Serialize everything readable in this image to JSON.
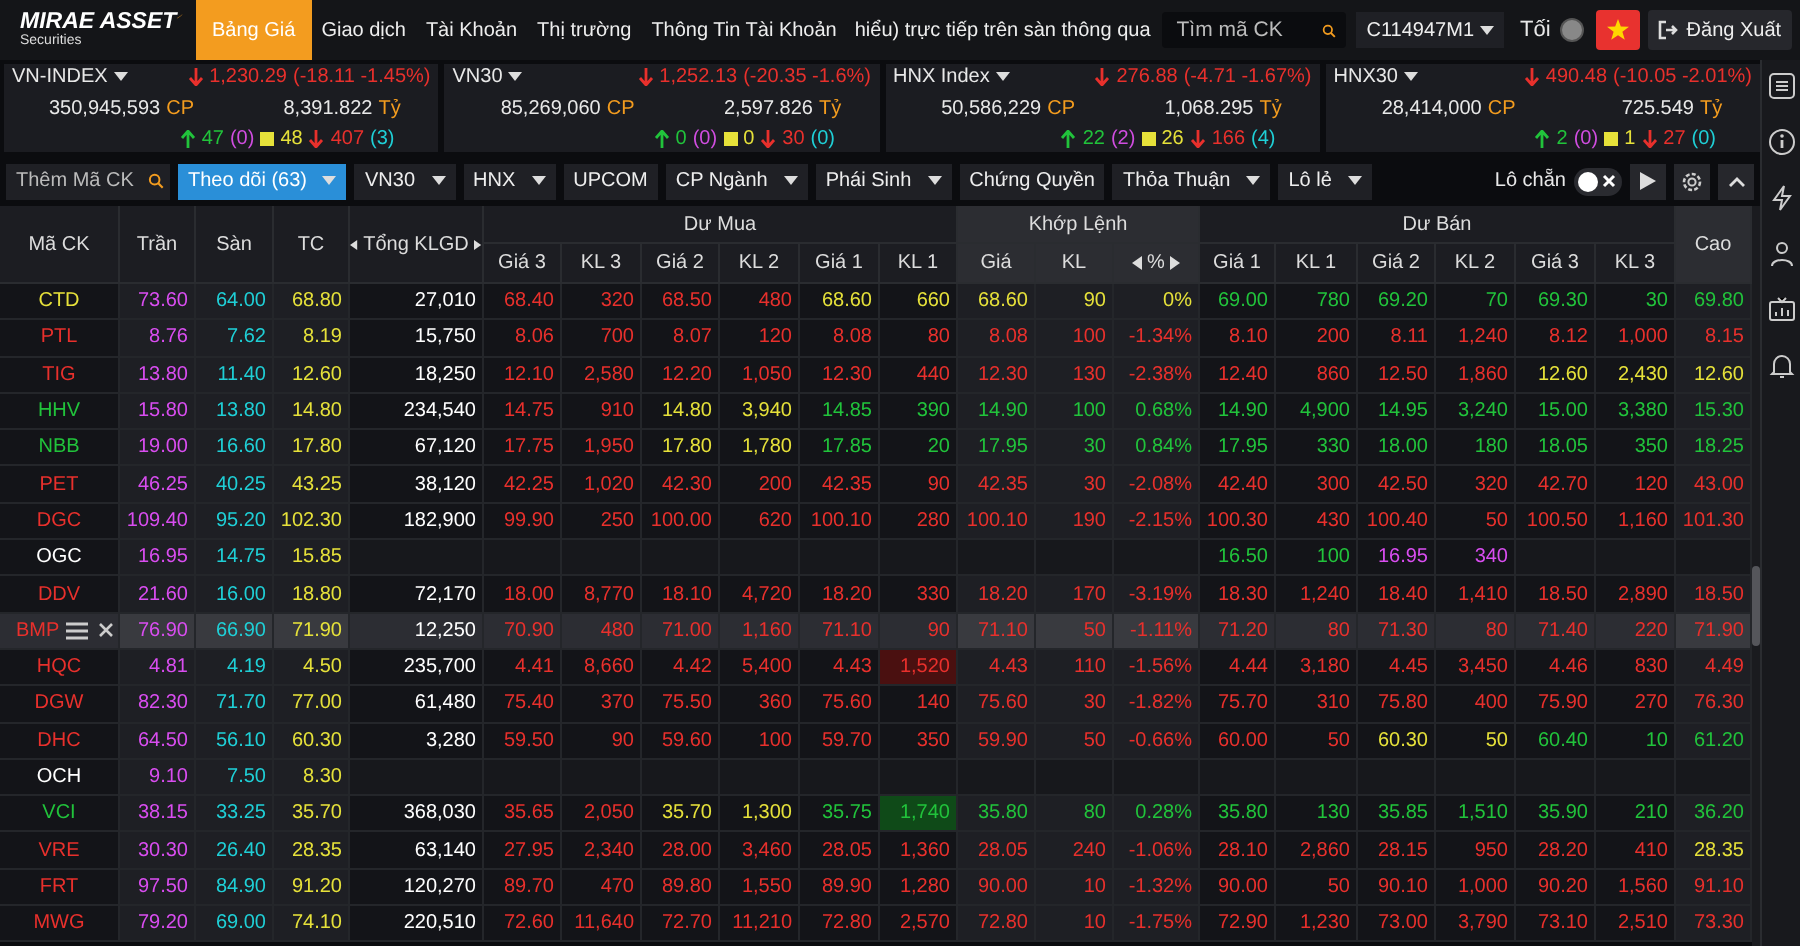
{
  "topnav": {
    "logo": {
      "name": "MIRAE ASSET",
      "tagline": "Securities"
    },
    "tabs": [
      {
        "label": "Bảng Giá",
        "selected": true
      },
      {
        "label": "Giao dịch",
        "selected": false
      },
      {
        "label": "Tài Khoản",
        "selected": false
      },
      {
        "label": "Thị trường",
        "selected": false
      },
      {
        "label": "Thông Tin Tài Khoản",
        "selected": false
      }
    ],
    "ticker": "hiểu) trực tiếp trên sàn thông qua",
    "search": {
      "placeholder": "Tìm mã CK"
    },
    "account": "C114947M1",
    "theme": {
      "label": "Tối",
      "on": false
    },
    "logout": "Đăng Xuất"
  },
  "indices": [
    {
      "name": "VN-INDEX",
      "value": "1,230.29",
      "change": "(-18.11 -1.45%)",
      "volume": "350,945,593",
      "volume_unit": "CP",
      "turnover": "8,391.822",
      "turnover_unit": "Tỷ",
      "up": "47",
      "ceil": "(0)",
      "ref": "48",
      "down": "407",
      "floor": "(3)"
    },
    {
      "name": "VN30",
      "value": "1,252.13",
      "change": "(-20.35 -1.6%)",
      "volume": "85,269,060",
      "volume_unit": "CP",
      "turnover": "2,597.826",
      "turnover_unit": "Tỷ",
      "up": "0",
      "ceil": "(0)",
      "ref": "0",
      "down": "30",
      "floor": "(0)"
    },
    {
      "name": "HNX Index",
      "value": "276.88",
      "change": "(-4.71 -1.67%)",
      "volume": "50,586,229",
      "volume_unit": "CP",
      "turnover": "1,068.295",
      "turnover_unit": "Tỷ",
      "up": "22",
      "ceil": "(2)",
      "ref": "26",
      "down": "166",
      "floor": "(4)"
    },
    {
      "name": "HNX30",
      "value": "490.48",
      "change": "(-10.05 -2.01%)",
      "volume": "28,414,000",
      "volume_unit": "CP",
      "turnover": "725.549",
      "turnover_unit": "Tỷ",
      "up": "2",
      "ceil": "(0)",
      "ref": "1",
      "down": "27",
      "floor": "(0)"
    }
  ],
  "toolbar": {
    "add_field": {
      "placeholder": "Thêm Mã CK"
    },
    "tabs": [
      {
        "label": "Theo dõi (63)",
        "selected": true,
        "dropdown": true
      },
      {
        "label": "VN30",
        "selected": false,
        "dropdown": true
      },
      {
        "label": "HNX",
        "selected": false,
        "dropdown": true
      },
      {
        "label": "UPCOM",
        "selected": false,
        "dropdown": false
      },
      {
        "label": "CP Ngành",
        "selected": false,
        "dropdown": true
      },
      {
        "label": "Phái Sinh",
        "selected": false,
        "dropdown": true
      },
      {
        "label": "Chứng Quyền",
        "selected": false,
        "dropdown": false
      },
      {
        "label": "Thỏa Thuận",
        "selected": false,
        "dropdown": true
      },
      {
        "label": "Lô lẻ",
        "selected": false,
        "dropdown": true
      }
    ],
    "odd_lot_toggle": {
      "label": "Lô chẵn",
      "on": false
    }
  },
  "board": {
    "columns": {
      "fixed": [
        {
          "label": "Mã CK",
          "arrows": false
        },
        {
          "label": "Trần",
          "arrows": false
        },
        {
          "label": "Sàn",
          "arrows": false
        },
        {
          "label": "TC",
          "arrows": false
        },
        {
          "label": "Tổng KLGD",
          "arrows": true
        }
      ],
      "groups": [
        {
          "label": "Dư Mua",
          "columns": [
            {
              "label": "Giá 3",
              "arrows": false
            },
            {
              "label": "KL 3",
              "arrows": false
            },
            {
              "label": "Giá 2",
              "arrows": false
            },
            {
              "label": "KL 2",
              "arrows": false
            },
            {
              "label": "Giá 1",
              "arrows": false
            },
            {
              "label": "KL 1",
              "arrows": false
            }
          ]
        },
        {
          "label": "Khớp Lệnh",
          "columns": [
            {
              "label": "Giá",
              "arrows": false
            },
            {
              "label": "KL",
              "arrows": false
            },
            {
              "label": "%",
              "arrows": true
            }
          ]
        },
        {
          "label": "Dư Bán",
          "columns": [
            {
              "label": "Giá 1",
              "arrows": false
            },
            {
              "label": "KL 1",
              "arrows": false
            },
            {
              "label": "Giá 2",
              "arrows": false
            },
            {
              "label": "KL 2",
              "arrows": false
            },
            {
              "label": "Giá 3",
              "arrows": false
            },
            {
              "label": "KL 3",
              "arrows": false
            }
          ]
        }
      ],
      "end": [
        {
          "label": "Cao",
          "arrows": false
        }
      ]
    },
    "rows": [
      {
        "code": "CTD",
        "color": "#e6e13a",
        "selected": false,
        "cells": [
          {
            "text": "73.60",
            "color": "#d94df0"
          },
          {
            "text": "64.00",
            "color": "#1fcfd6"
          },
          {
            "text": "68.80",
            "color": "#e6e13a"
          },
          {
            "text": "27,010",
            "color": "#ffffff"
          },
          {
            "text": "68.40",
            "color": "#e8302c"
          },
          {
            "text": "320",
            "color": "#e8302c"
          },
          {
            "text": "68.50",
            "color": "#e8302c"
          },
          {
            "text": "480",
            "color": "#e8302c"
          },
          {
            "text": "68.60",
            "color": "#e6e13a"
          },
          {
            "text": "660",
            "color": "#e6e13a"
          },
          {
            "text": "68.60",
            "color": "#e6e13a"
          },
          {
            "text": "90",
            "color": "#e6e13a"
          },
          {
            "text": "0%",
            "color": "#e6e13a"
          },
          {
            "text": "69.00",
            "color": "#21c33b"
          },
          {
            "text": "780",
            "color": "#21c33b"
          },
          {
            "text": "69.20",
            "color": "#21c33b"
          },
          {
            "text": "70",
            "color": "#21c33b"
          },
          {
            "text": "69.30",
            "color": "#21c33b"
          },
          {
            "text": "30",
            "color": "#21c33b"
          },
          {
            "text": "69.80",
            "color": "#21c33b"
          }
        ]
      },
      {
        "code": "PTL",
        "color": "#e8302c",
        "selected": false,
        "cells": [
          {
            "text": "8.76",
            "color": "#d94df0"
          },
          {
            "text": "7.62",
            "color": "#1fcfd6"
          },
          {
            "text": "8.19",
            "color": "#e6e13a"
          },
          {
            "text": "15,750",
            "color": "#ffffff"
          },
          {
            "text": "8.06",
            "color": "#e8302c"
          },
          {
            "text": "700",
            "color": "#e8302c"
          },
          {
            "text": "8.07",
            "color": "#e8302c"
          },
          {
            "text": "120",
            "color": "#e8302c"
          },
          {
            "text": "8.08",
            "color": "#e8302c"
          },
          {
            "text": "80",
            "color": "#e8302c"
          },
          {
            "text": "8.08",
            "color": "#e8302c"
          },
          {
            "text": "100",
            "color": "#e8302c"
          },
          {
            "text": "-1.34%",
            "color": "#e8302c"
          },
          {
            "text": "8.10",
            "color": "#e8302c"
          },
          {
            "text": "200",
            "color": "#e8302c"
          },
          {
            "text": "8.11",
            "color": "#e8302c"
          },
          {
            "text": "1,240",
            "color": "#e8302c"
          },
          {
            "text": "8.12",
            "color": "#e8302c"
          },
          {
            "text": "1,000",
            "color": "#e8302c"
          },
          {
            "text": "8.15",
            "color": "#e8302c"
          }
        ]
      },
      {
        "code": "TIG",
        "color": "#e8302c",
        "selected": false,
        "cells": [
          {
            "text": "13.80",
            "color": "#d94df0"
          },
          {
            "text": "11.40",
            "color": "#1fcfd6"
          },
          {
            "text": "12.60",
            "color": "#e6e13a"
          },
          {
            "text": "18,250",
            "color": "#ffffff"
          },
          {
            "text": "12.10",
            "color": "#e8302c"
          },
          {
            "text": "2,580",
            "color": "#e8302c"
          },
          {
            "text": "12.20",
            "color": "#e8302c"
          },
          {
            "text": "1,050",
            "color": "#e8302c"
          },
          {
            "text": "12.30",
            "color": "#e8302c"
          },
          {
            "text": "440",
            "color": "#e8302c"
          },
          {
            "text": "12.30",
            "color": "#e8302c"
          },
          {
            "text": "130",
            "color": "#e8302c"
          },
          {
            "text": "-2.38%",
            "color": "#e8302c"
          },
          {
            "text": "12.40",
            "color": "#e8302c"
          },
          {
            "text": "860",
            "color": "#e8302c"
          },
          {
            "text": "12.50",
            "color": "#e8302c"
          },
          {
            "text": "1,860",
            "color": "#e8302c"
          },
          {
            "text": "12.60",
            "color": "#e6e13a"
          },
          {
            "text": "2,430",
            "color": "#e6e13a"
          },
          {
            "text": "12.60",
            "color": "#e6e13a"
          }
        ]
      },
      {
        "code": "HHV",
        "color": "#21c33b",
        "selected": false,
        "cells": [
          {
            "text": "15.80",
            "color": "#d94df0"
          },
          {
            "text": "13.80",
            "color": "#1fcfd6"
          },
          {
            "text": "14.80",
            "color": "#e6e13a"
          },
          {
            "text": "234,540",
            "color": "#ffffff"
          },
          {
            "text": "14.75",
            "color": "#e8302c"
          },
          {
            "text": "910",
            "color": "#e8302c"
          },
          {
            "text": "14.80",
            "color": "#e6e13a"
          },
          {
            "text": "3,940",
            "color": "#e6e13a"
          },
          {
            "text": "14.85",
            "color": "#21c33b"
          },
          {
            "text": "390",
            "color": "#21c33b"
          },
          {
            "text": "14.90",
            "color": "#21c33b"
          },
          {
            "text": "100",
            "color": "#21c33b"
          },
          {
            "text": "0.68%",
            "color": "#21c33b"
          },
          {
            "text": "14.90",
            "color": "#21c33b"
          },
          {
            "text": "4,900",
            "color": "#21c33b"
          },
          {
            "text": "14.95",
            "color": "#21c33b"
          },
          {
            "text": "3,240",
            "color": "#21c33b"
          },
          {
            "text": "15.00",
            "color": "#21c33b"
          },
          {
            "text": "3,380",
            "color": "#21c33b"
          },
          {
            "text": "15.30",
            "color": "#21c33b"
          }
        ]
      },
      {
        "code": "NBB",
        "color": "#21c33b",
        "selected": false,
        "cells": [
          {
            "text": "19.00",
            "color": "#d94df0"
          },
          {
            "text": "16.60",
            "color": "#1fcfd6"
          },
          {
            "text": "17.80",
            "color": "#e6e13a"
          },
          {
            "text": "67,120",
            "color": "#ffffff"
          },
          {
            "text": "17.75",
            "color": "#e8302c"
          },
          {
            "text": "1,950",
            "color": "#e8302c"
          },
          {
            "text": "17.80",
            "color": "#e6e13a"
          },
          {
            "text": "1,780",
            "color": "#e6e13a"
          },
          {
            "text": "17.85",
            "color": "#21c33b"
          },
          {
            "text": "20",
            "color": "#21c33b"
          },
          {
            "text": "17.95",
            "color": "#21c33b"
          },
          {
            "text": "30",
            "color": "#21c33b"
          },
          {
            "text": "0.84%",
            "color": "#21c33b"
          },
          {
            "text": "17.95",
            "color": "#21c33b"
          },
          {
            "text": "330",
            "color": "#21c33b"
          },
          {
            "text": "18.00",
            "color": "#21c33b"
          },
          {
            "text": "180",
            "color": "#21c33b"
          },
          {
            "text": "18.05",
            "color": "#21c33b"
          },
          {
            "text": "350",
            "color": "#21c33b"
          },
          {
            "text": "18.25",
            "color": "#21c33b"
          }
        ]
      },
      {
        "code": "PET",
        "color": "#e8302c",
        "selected": false,
        "cells": [
          {
            "text": "46.25",
            "color": "#d94df0"
          },
          {
            "text": "40.25",
            "color": "#1fcfd6"
          },
          {
            "text": "43.25",
            "color": "#e6e13a"
          },
          {
            "text": "38,120",
            "color": "#ffffff"
          },
          {
            "text": "42.25",
            "color": "#e8302c"
          },
          {
            "text": "1,020",
            "color": "#e8302c"
          },
          {
            "text": "42.30",
            "color": "#e8302c"
          },
          {
            "text": "200",
            "color": "#e8302c"
          },
          {
            "text": "42.35",
            "color": "#e8302c"
          },
          {
            "text": "90",
            "color": "#e8302c"
          },
          {
            "text": "42.35",
            "color": "#e8302c"
          },
          {
            "text": "30",
            "color": "#e8302c"
          },
          {
            "text": "-2.08%",
            "color": "#e8302c"
          },
          {
            "text": "42.40",
            "color": "#e8302c"
          },
          {
            "text": "300",
            "color": "#e8302c"
          },
          {
            "text": "42.50",
            "color": "#e8302c"
          },
          {
            "text": "320",
            "color": "#e8302c"
          },
          {
            "text": "42.70",
            "color": "#e8302c"
          },
          {
            "text": "120",
            "color": "#e8302c"
          },
          {
            "text": "43.00",
            "color": "#e8302c"
          }
        ]
      },
      {
        "code": "DGC",
        "color": "#e8302c",
        "selected": false,
        "cells": [
          {
            "text": "109.40",
            "color": "#d94df0"
          },
          {
            "text": "95.20",
            "color": "#1fcfd6"
          },
          {
            "text": "102.30",
            "color": "#e6e13a"
          },
          {
            "text": "182,900",
            "color": "#ffffff"
          },
          {
            "text": "99.90",
            "color": "#e8302c"
          },
          {
            "text": "250",
            "color": "#e8302c"
          },
          {
            "text": "100.00",
            "color": "#e8302c"
          },
          {
            "text": "620",
            "color": "#e8302c"
          },
          {
            "text": "100.10",
            "color": "#e8302c"
          },
          {
            "text": "280",
            "color": "#e8302c"
          },
          {
            "text": "100.10",
            "color": "#e8302c"
          },
          {
            "text": "190",
            "color": "#e8302c"
          },
          {
            "text": "-2.15%",
            "color": "#e8302c"
          },
          {
            "text": "100.30",
            "color": "#e8302c"
          },
          {
            "text": "430",
            "color": "#e8302c"
          },
          {
            "text": "100.40",
            "color": "#e8302c"
          },
          {
            "text": "50",
            "color": "#e8302c"
          },
          {
            "text": "100.50",
            "color": "#e8302c"
          },
          {
            "text": "1,160",
            "color": "#e8302c"
          },
          {
            "text": "101.30",
            "color": "#e8302c"
          }
        ]
      },
      {
        "code": "OGC",
        "color": "#ffffff",
        "selected": false,
        "cells": [
          {
            "text": "16.95",
            "color": "#d94df0"
          },
          {
            "text": "14.75",
            "color": "#1fcfd6"
          },
          {
            "text": "15.85",
            "color": "#e6e13a"
          },
          null,
          null,
          null,
          null,
          null,
          null,
          null,
          null,
          null,
          null,
          {
            "text": "16.50",
            "color": "#21c33b"
          },
          {
            "text": "100",
            "color": "#21c33b"
          },
          {
            "text": "16.95",
            "color": "#d94df0"
          },
          {
            "text": "340",
            "color": "#d94df0"
          },
          null,
          null,
          null
        ]
      },
      {
        "code": "DDV",
        "color": "#e8302c",
        "selected": false,
        "cells": [
          {
            "text": "21.60",
            "color": "#d94df0"
          },
          {
            "text": "16.00",
            "color": "#1fcfd6"
          },
          {
            "text": "18.80",
            "color": "#e6e13a"
          },
          {
            "text": "72,170",
            "color": "#ffffff"
          },
          {
            "text": "18.00",
            "color": "#e8302c"
          },
          {
            "text": "8,770",
            "color": "#e8302c"
          },
          {
            "text": "18.10",
            "color": "#e8302c"
          },
          {
            "text": "4,720",
            "color": "#e8302c"
          },
          {
            "text": "18.20",
            "color": "#e8302c"
          },
          {
            "text": "330",
            "color": "#e8302c"
          },
          {
            "text": "18.20",
            "color": "#e8302c"
          },
          {
            "text": "170",
            "color": "#e8302c"
          },
          {
            "text": "-3.19%",
            "color": "#e8302c"
          },
          {
            "text": "18.30",
            "color": "#e8302c"
          },
          {
            "text": "1,240",
            "color": "#e8302c"
          },
          {
            "text": "18.40",
            "color": "#e8302c"
          },
          {
            "text": "1,410",
            "color": "#e8302c"
          },
          {
            "text": "18.50",
            "color": "#e8302c"
          },
          {
            "text": "2,890",
            "color": "#e8302c"
          },
          {
            "text": "18.50",
            "color": "#e8302c"
          }
        ]
      },
      {
        "code": "BMP",
        "color": "#e8302c",
        "selected": true,
        "cells": [
          {
            "text": "76.90",
            "color": "#d94df0"
          },
          {
            "text": "66.90",
            "color": "#1fcfd6"
          },
          {
            "text": "71.90",
            "color": "#e6e13a"
          },
          {
            "text": "12,250",
            "color": "#ffffff"
          },
          {
            "text": "70.90",
            "color": "#e8302c"
          },
          {
            "text": "480",
            "color": "#e8302c"
          },
          {
            "text": "71.00",
            "color": "#e8302c"
          },
          {
            "text": "1,160",
            "color": "#e8302c"
          },
          {
            "text": "71.10",
            "color": "#e8302c"
          },
          {
            "text": "90",
            "color": "#e8302c"
          },
          {
            "text": "71.10",
            "color": "#e8302c"
          },
          {
            "text": "50",
            "color": "#e8302c"
          },
          {
            "text": "-1.11%",
            "color": "#e8302c"
          },
          {
            "text": "71.20",
            "color": "#e8302c"
          },
          {
            "text": "80",
            "color": "#e8302c"
          },
          {
            "text": "71.30",
            "color": "#e8302c"
          },
          {
            "text": "80",
            "color": "#e8302c"
          },
          {
            "text": "71.40",
            "color": "#e8302c"
          },
          {
            "text": "220",
            "color": "#e8302c"
          },
          {
            "text": "71.90",
            "color": "#e8302c"
          }
        ]
      },
      {
        "code": "HQC",
        "color": "#e8302c",
        "selected": false,
        "cells": [
          {
            "text": "4.81",
            "color": "#d94df0"
          },
          {
            "text": "4.19",
            "color": "#1fcfd6"
          },
          {
            "text": "4.50",
            "color": "#e6e13a"
          },
          {
            "text": "235,700",
            "color": "#ffffff"
          },
          {
            "text": "4.41",
            "color": "#e8302c"
          },
          {
            "text": "8,660",
            "color": "#e8302c"
          },
          {
            "text": "4.42",
            "color": "#e8302c"
          },
          {
            "text": "5,400",
            "color": "#e8302c"
          },
          {
            "text": "4.43",
            "color": "#e8302c"
          },
          {
            "text": "1,520",
            "color": "#e8302c",
            "flash": true
          },
          {
            "text": "4.43",
            "color": "#e8302c"
          },
          {
            "text": "110",
            "color": "#e8302c"
          },
          {
            "text": "-1.56%",
            "color": "#e8302c"
          },
          {
            "text": "4.44",
            "color": "#e8302c"
          },
          {
            "text": "3,180",
            "color": "#e8302c"
          },
          {
            "text": "4.45",
            "color": "#e8302c"
          },
          {
            "text": "3,450",
            "color": "#e8302c"
          },
          {
            "text": "4.46",
            "color": "#e8302c"
          },
          {
            "text": "830",
            "color": "#e8302c"
          },
          {
            "text": "4.49",
            "color": "#e8302c"
          }
        ]
      },
      {
        "code": "DGW",
        "color": "#e8302c",
        "selected": false,
        "cells": [
          {
            "text": "82.30",
            "color": "#d94df0"
          },
          {
            "text": "71.70",
            "color": "#1fcfd6"
          },
          {
            "text": "77.00",
            "color": "#e6e13a"
          },
          {
            "text": "61,480",
            "color": "#ffffff"
          },
          {
            "text": "75.40",
            "color": "#e8302c"
          },
          {
            "text": "370",
            "color": "#e8302c"
          },
          {
            "text": "75.50",
            "color": "#e8302c"
          },
          {
            "text": "360",
            "color": "#e8302c"
          },
          {
            "text": "75.60",
            "color": "#e8302c"
          },
          {
            "text": "140",
            "color": "#e8302c"
          },
          {
            "text": "75.60",
            "color": "#e8302c"
          },
          {
            "text": "30",
            "color": "#e8302c"
          },
          {
            "text": "-1.82%",
            "color": "#e8302c"
          },
          {
            "text": "75.70",
            "color": "#e8302c"
          },
          {
            "text": "310",
            "color": "#e8302c"
          },
          {
            "text": "75.80",
            "color": "#e8302c"
          },
          {
            "text": "400",
            "color": "#e8302c"
          },
          {
            "text": "75.90",
            "color": "#e8302c"
          },
          {
            "text": "270",
            "color": "#e8302c"
          },
          {
            "text": "76.30",
            "color": "#e8302c"
          }
        ]
      },
      {
        "code": "DHC",
        "color": "#e8302c",
        "selected": false,
        "cells": [
          {
            "text": "64.50",
            "color": "#d94df0"
          },
          {
            "text": "56.10",
            "color": "#1fcfd6"
          },
          {
            "text": "60.30",
            "color": "#e6e13a"
          },
          {
            "text": "3,280",
            "color": "#ffffff"
          },
          {
            "text": "59.50",
            "color": "#e8302c"
          },
          {
            "text": "90",
            "color": "#e8302c"
          },
          {
            "text": "59.60",
            "color": "#e8302c"
          },
          {
            "text": "100",
            "color": "#e8302c"
          },
          {
            "text": "59.70",
            "color": "#e8302c"
          },
          {
            "text": "350",
            "color": "#e8302c"
          },
          {
            "text": "59.90",
            "color": "#e8302c"
          },
          {
            "text": "50",
            "color": "#e8302c"
          },
          {
            "text": "-0.66%",
            "color": "#e8302c"
          },
          {
            "text": "60.00",
            "color": "#e8302c"
          },
          {
            "text": "50",
            "color": "#e8302c"
          },
          {
            "text": "60.30",
            "color": "#e6e13a"
          },
          {
            "text": "50",
            "color": "#e6e13a"
          },
          {
            "text": "60.40",
            "color": "#21c33b"
          },
          {
            "text": "10",
            "color": "#21c33b"
          },
          {
            "text": "61.20",
            "color": "#21c33b"
          }
        ]
      },
      {
        "code": "OCH",
        "color": "#ffffff",
        "selected": false,
        "cells": [
          {
            "text": "9.10",
            "color": "#d94df0"
          },
          {
            "text": "7.50",
            "color": "#1fcfd6"
          },
          {
            "text": "8.30",
            "color": "#e6e13a"
          },
          null,
          null,
          null,
          null,
          null,
          null,
          null,
          null,
          null,
          null,
          null,
          null,
          null,
          null,
          null,
          null,
          null
        ]
      },
      {
        "code": "VCI",
        "color": "#21c33b",
        "selected": false,
        "cells": [
          {
            "text": "38.15",
            "color": "#d94df0"
          },
          {
            "text": "33.25",
            "color": "#1fcfd6"
          },
          {
            "text": "35.70",
            "color": "#e6e13a"
          },
          {
            "text": "368,030",
            "color": "#ffffff"
          },
          {
            "text": "35.65",
            "color": "#e8302c"
          },
          {
            "text": "2,050",
            "color": "#e8302c"
          },
          {
            "text": "35.70",
            "color": "#e6e13a"
          },
          {
            "text": "1,300",
            "color": "#e6e13a"
          },
          {
            "text": "35.75",
            "color": "#21c33b"
          },
          {
            "text": "1,740",
            "color": "#21c33b",
            "flash": true
          },
          {
            "text": "35.80",
            "color": "#21c33b"
          },
          {
            "text": "80",
            "color": "#21c33b"
          },
          {
            "text": "0.28%",
            "color": "#21c33b"
          },
          {
            "text": "35.80",
            "color": "#21c33b"
          },
          {
            "text": "130",
            "color": "#21c33b"
          },
          {
            "text": "35.85",
            "color": "#21c33b"
          },
          {
            "text": "1,510",
            "color": "#21c33b"
          },
          {
            "text": "35.90",
            "color": "#21c33b"
          },
          {
            "text": "210",
            "color": "#21c33b"
          },
          {
            "text": "36.20",
            "color": "#21c33b"
          }
        ]
      },
      {
        "code": "VRE",
        "color": "#e8302c",
        "selected": false,
        "cells": [
          {
            "text": "30.30",
            "color": "#d94df0"
          },
          {
            "text": "26.40",
            "color": "#1fcfd6"
          },
          {
            "text": "28.35",
            "color": "#e6e13a"
          },
          {
            "text": "63,140",
            "color": "#ffffff"
          },
          {
            "text": "27.95",
            "color": "#e8302c"
          },
          {
            "text": "2,340",
            "color": "#e8302c"
          },
          {
            "text": "28.00",
            "color": "#e8302c"
          },
          {
            "text": "3,460",
            "color": "#e8302c"
          },
          {
            "text": "28.05",
            "color": "#e8302c"
          },
          {
            "text": "1,360",
            "color": "#e8302c"
          },
          {
            "text": "28.05",
            "color": "#e8302c"
          },
          {
            "text": "240",
            "color": "#e8302c"
          },
          {
            "text": "-1.06%",
            "color": "#e8302c"
          },
          {
            "text": "28.10",
            "color": "#e8302c"
          },
          {
            "text": "2,860",
            "color": "#e8302c"
          },
          {
            "text": "28.15",
            "color": "#e8302c"
          },
          {
            "text": "950",
            "color": "#e8302c"
          },
          {
            "text": "28.20",
            "color": "#e8302c"
          },
          {
            "text": "410",
            "color": "#e8302c"
          },
          {
            "text": "28.35",
            "color": "#e6e13a"
          }
        ]
      },
      {
        "code": "FRT",
        "color": "#e8302c",
        "selected": false,
        "cells": [
          {
            "text": "97.50",
            "color": "#d94df0"
          },
          {
            "text": "84.90",
            "color": "#1fcfd6"
          },
          {
            "text": "91.20",
            "color": "#e6e13a"
          },
          {
            "text": "120,270",
            "color": "#ffffff"
          },
          {
            "text": "89.70",
            "color": "#e8302c"
          },
          {
            "text": "470",
            "color": "#e8302c"
          },
          {
            "text": "89.80",
            "color": "#e8302c"
          },
          {
            "text": "1,550",
            "color": "#e8302c"
          },
          {
            "text": "89.90",
            "color": "#e8302c"
          },
          {
            "text": "1,280",
            "color": "#e8302c"
          },
          {
            "text": "90.00",
            "color": "#e8302c"
          },
          {
            "text": "10",
            "color": "#e8302c"
          },
          {
            "text": "-1.32%",
            "color": "#e8302c"
          },
          {
            "text": "90.00",
            "color": "#e8302c"
          },
          {
            "text": "50",
            "color": "#e8302c"
          },
          {
            "text": "90.10",
            "color": "#e8302c"
          },
          {
            "text": "1,000",
            "color": "#e8302c"
          },
          {
            "text": "90.20",
            "color": "#e8302c"
          },
          {
            "text": "1,560",
            "color": "#e8302c"
          },
          {
            "text": "91.10",
            "color": "#e8302c"
          }
        ]
      },
      {
        "code": "MWG",
        "color": "#e8302c",
        "selected": false,
        "cells": [
          {
            "text": "79.20",
            "color": "#d94df0"
          },
          {
            "text": "69.00",
            "color": "#1fcfd6"
          },
          {
            "text": "74.10",
            "color": "#e6e13a"
          },
          {
            "text": "220,510",
            "color": "#ffffff"
          },
          {
            "text": "72.60",
            "color": "#e8302c"
          },
          {
            "text": "11,640",
            "color": "#e8302c"
          },
          {
            "text": "72.70",
            "color": "#e8302c"
          },
          {
            "text": "11,210",
            "color": "#e8302c"
          },
          {
            "text": "72.80",
            "color": "#e8302c"
          },
          {
            "text": "2,570",
            "color": "#e8302c"
          },
          {
            "text": "72.80",
            "color": "#e8302c"
          },
          {
            "text": "10",
            "color": "#e8302c"
          },
          {
            "text": "-1.75%",
            "color": "#e8302c"
          },
          {
            "text": "72.90",
            "color": "#e8302c"
          },
          {
            "text": "1,230",
            "color": "#e8302c"
          },
          {
            "text": "73.00",
            "color": "#e8302c"
          },
          {
            "text": "3,790",
            "color": "#e8302c"
          },
          {
            "text": "73.10",
            "color": "#e8302c"
          },
          {
            "text": "2,510",
            "color": "#e8302c"
          },
          {
            "text": "73.30",
            "color": "#e8302c"
          }
        ]
      }
    ]
  }
}
